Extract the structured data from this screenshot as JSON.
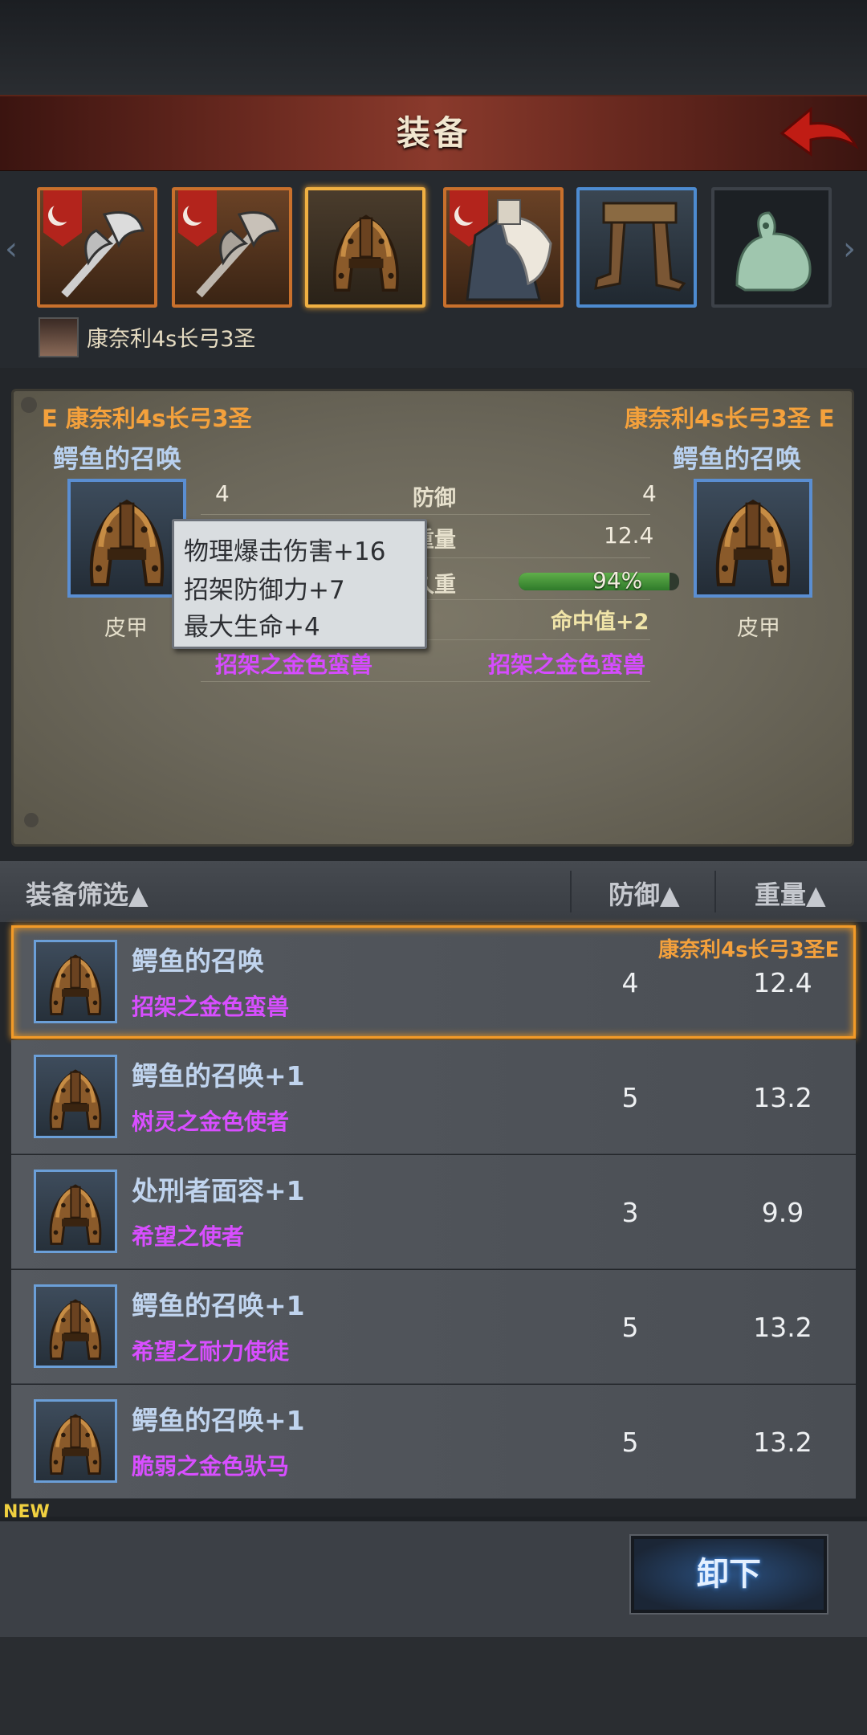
{
  "header": {
    "title": "装备"
  },
  "owner": {
    "name": "康奈利4s长弓3圣"
  },
  "slots": [
    {
      "icon": "halberd-icon",
      "badge": "crest-banner"
    },
    {
      "icon": "halberd-icon",
      "badge": "crest-banner"
    },
    {
      "icon": "helmet-icon"
    },
    {
      "icon": "fur-coat-icon",
      "badge": "crest-banner"
    },
    {
      "icon": "boots-icon"
    },
    {
      "icon": "jade-rat-icon"
    }
  ],
  "compare": {
    "left": {
      "owner": "E 康奈利4s长弓3圣",
      "name": "鳄鱼的召唤",
      "type": "皮甲",
      "enchant": "招架之金色蛮兽"
    },
    "right": {
      "owner": "康奈利4s长弓3圣 E",
      "name": "鳄鱼的召唤",
      "type": "皮甲",
      "enchant": "招架之金色蛮兽",
      "hit": "命中值+2"
    },
    "stats": {
      "defense_label": "防御",
      "defense_left": "4",
      "defense_right": "4",
      "weight_label": "重量",
      "weight_right": "12.4",
      "dur_label": "久重",
      "dur_value": "94%",
      "dur_fraction": 0.94
    },
    "tooltip": [
      "物理爆击伤害+16",
      "招架防御力+7",
      "最大生命+4"
    ]
  },
  "list": {
    "filter_label": "装备筛选▲",
    "defense_label": "防御▲",
    "weight_label": "重量▲",
    "rows": [
      {
        "name": "鳄鱼的召唤",
        "sub": "招架之金色蛮兽",
        "defense": "4",
        "weight": "12.4",
        "owner": "康奈利4s长弓3圣E"
      },
      {
        "name": "鳄鱼的召唤+1",
        "sub": "树灵之金色使者",
        "defense": "5",
        "weight": "13.2"
      },
      {
        "name": "处刑者面容+1",
        "sub": "希望之使者",
        "defense": "3",
        "weight": "9.9"
      },
      {
        "name": "鳄鱼的召唤+1",
        "sub": "希望之耐力使徒",
        "defense": "5",
        "weight": "13.2"
      },
      {
        "name": "鳄鱼的召唤+1",
        "sub": "脆弱之金色驮马",
        "defense": "5",
        "weight": "13.2"
      }
    ]
  },
  "new_tag": "NEW",
  "unequip_label": "卸下"
}
